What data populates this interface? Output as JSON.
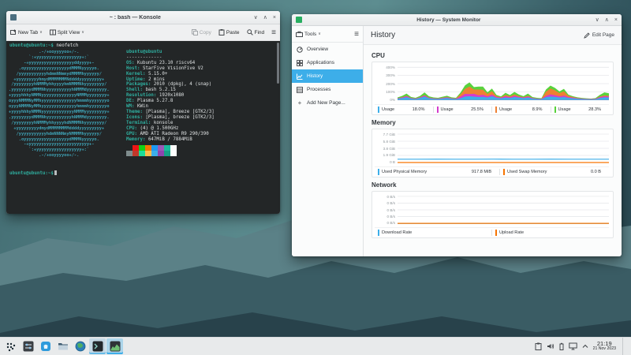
{
  "colors": {
    "accent": "#3daee9",
    "terminal_bg": "#232627",
    "terminal_green": "#2fae9f",
    "ascii_teal": "#3fa3b6"
  },
  "konsole": {
    "window_title": "~ : bash — Konsole",
    "toolbar": {
      "new_tab": "New Tab",
      "split_view": "Split View",
      "copy": "Copy",
      "paste": "Paste",
      "find": "Find"
    },
    "command_line": {
      "prompt": "ubuntu@ubuntu:~$",
      "command": "neofetch"
    },
    "ascii_art": [
      "            .-/+ooyyyyoo+/-.",
      "        `:+yyyyyyyyyyyyyyyyyy+:`",
      "      -+yyyyyyyyyyyyyyyyyyddyyyy+-",
      "    .oyyyyyyyyyyyyyyyyyydMMMNyyyyyo.",
      "   /yyyyyyyyyyyhdmmNNmmydMMMMhyyyyyy/",
      "  +yyyyyyyyyhmydMMMMMMMNddddyyyyyyyyy+",
      " /yyyyyyyyhNMMMyhhyyyyhmNMMMNhyyyyyyyy/",
      ".yyyyyyyydMMMNhyyyyyyyyyyhNMMMdyyyyyyyy.",
      "+yyyyhhhyNMMNyyyyyyyyyyyyyyNMMMyyyyyyyy+",
      "oyyyNMMMNyMMhyyyyyyyyyyyyyyhmmmhyyyyyyyo",
      "oyyyNMMMNyMMhyyyyyyyyyyyyyyhmmmhyyyyyyyo",
      "+yyyyhhhyNMMNyyyyyyyyyyyyyNMMMyyyyyyyyy+",
      ".yyyyyyyydMMMNhyyyyyyyyyyhNMMMdyyyyyyyy.",
      " /yyyyyyyyhNMMMyhhyyyyhdNMMMNhyyyyyyyy/",
      "  +yyyyyyyyydmydMMMMMMMMddddyyyyyyyyy+",
      "   /yyyyyyyyyyyhdmNNNNmyNMMMMhyyyyyy/",
      "    .oyyyyyyyyyyyyyyyyyydMMMNyyyyyo.",
      "      -+yyyyyyyyyyyyyyyyyyyyyyyy+-",
      "        `:+yyyyyyyyyyyyyyyyyy+:`",
      "            .-/+ooyyyyoo+/-."
    ],
    "info_header": "ubuntu@ubuntu",
    "info_divider": "-------------",
    "info": [
      {
        "label": "OS",
        "value": "Kubuntu 23.10 riscv64"
      },
      {
        "label": "Host",
        "value": "StarFive VisionFive V2"
      },
      {
        "label": "Kernel",
        "value": "5.15.0+"
      },
      {
        "label": "Uptime",
        "value": "2 mins"
      },
      {
        "label": "Packages",
        "value": "2010 (dpkg), 4 (snap)"
      },
      {
        "label": "Shell",
        "value": "bash 5.2.15"
      },
      {
        "label": "Resolution",
        "value": "1920x1080"
      },
      {
        "label": "DE",
        "value": "Plasma 5.27.8"
      },
      {
        "label": "WM",
        "value": "KWin"
      },
      {
        "label": "Theme",
        "value": "[Plasma], Breeze [GTK2/3]"
      },
      {
        "label": "Icons",
        "value": "[Plasma], breeze [GTK2/3]"
      },
      {
        "label": "Terminal",
        "value": "konsole"
      },
      {
        "label": "CPU",
        "value": "(4) @ 1.500GHz"
      },
      {
        "label": "GPU",
        "value": "AMD ATI Radeon R9 290/390"
      },
      {
        "label": "Memory",
        "value": "647MiB / 7884MiB"
      }
    ],
    "palette_normal": [
      "#232627",
      "#ed1515",
      "#11d116",
      "#f67400",
      "#1d99f3",
      "#9b59b6",
      "#1abc9c",
      "#fcfcfc"
    ],
    "palette_bright": [
      "#7f8c8d",
      "#c0392b",
      "#1cdc9a",
      "#fdbc4b",
      "#3daee9",
      "#8e44ad",
      "#16a085",
      "#ffffff"
    ]
  },
  "sysmon": {
    "window_title": "History — System Monitor",
    "tools_label": "Tools",
    "sidebar_items": [
      {
        "label": "Overview"
      },
      {
        "label": "Applications"
      },
      {
        "label": "History"
      },
      {
        "label": "Processes"
      },
      {
        "label": "Add New Page..."
      }
    ],
    "page_title": "History",
    "edit_page_label": "Edit Page",
    "section_titles": {
      "cpu": "CPU",
      "memory": "Memory",
      "network": "Network"
    }
  },
  "chart_data": [
    {
      "type": "area",
      "stacked": true,
      "title": "CPU",
      "ymax": 400,
      "ylim": [
        0,
        400
      ],
      "ylabels": [
        "400%",
        "300%",
        "200%",
        "100%",
        "0%"
      ],
      "legend_position": "bottom",
      "series": [
        {
          "name": "Usage",
          "value": "18.0%",
          "color": "#3daee9",
          "points": [
            15,
            22,
            35,
            18,
            12,
            25,
            42,
            20,
            14,
            12,
            18,
            24,
            15,
            12,
            20,
            42,
            46,
            40,
            36,
            38,
            30,
            46,
            26,
            20,
            30,
            24,
            36,
            28,
            22,
            30,
            18,
            12,
            10,
            34,
            42,
            38,
            30,
            36,
            25,
            20,
            15,
            12,
            10,
            8,
            10,
            24,
            32,
            30
          ]
        },
        {
          "name": "Usage",
          "value": "25.5%",
          "color": "#d43ccc",
          "points": [
            4,
            8,
            12,
            5,
            4,
            6,
            12,
            6,
            5,
            4,
            6,
            8,
            5,
            4,
            20,
            32,
            26,
            36,
            20,
            26,
            14,
            20,
            10,
            8,
            16,
            10,
            16,
            10,
            8,
            12,
            5,
            4,
            3,
            16,
            26,
            20,
            14,
            18,
            10,
            8,
            5,
            4,
            3,
            3,
            4,
            10,
            14,
            12
          ]
        },
        {
          "name": "Usage",
          "value": "8.9%",
          "color": "#ee8033",
          "points": [
            2,
            3,
            5,
            2,
            2,
            3,
            6,
            3,
            2,
            2,
            3,
            4,
            2,
            2,
            30,
            62,
            92,
            52,
            72,
            60,
            30,
            42,
            10,
            5,
            16,
            10,
            16,
            8,
            5,
            10,
            3,
            2,
            2,
            52,
            72,
            60,
            40,
            52,
            15,
            8,
            4,
            3,
            2,
            2,
            2,
            8,
            10,
            8
          ]
        },
        {
          "name": "Usage",
          "value": "28.3%",
          "color": "#58d23d",
          "points": [
            10,
            16,
            26,
            12,
            8,
            15,
            32,
            15,
            10,
            8,
            12,
            16,
            10,
            8,
            20,
            42,
            52,
            30,
            36,
            40,
            20,
            32,
            15,
            10,
            26,
            16,
            30,
            20,
            12,
            26,
            10,
            8,
            6,
            26,
            36,
            30,
            20,
            30,
            15,
            10,
            8,
            6,
            5,
            4,
            6,
            20,
            36,
            32
          ]
        }
      ]
    },
    {
      "type": "line",
      "stacked": false,
      "title": "Memory",
      "ymax": 7.7,
      "ylim": [
        0,
        7.7
      ],
      "ylabels": [
        "7.7 GiB",
        "5.8 GiB",
        "3.8 GiB",
        "1.9 GiB",
        "0 B"
      ],
      "legend_position": "bottom",
      "series": [
        {
          "name": "Used Physical Memory",
          "value": "917.8 MiB",
          "color": "#3daee9",
          "points": [
            0.9,
            0.9,
            0.91,
            0.9,
            0.9,
            0.92,
            0.9,
            0.9,
            0.91,
            0.9,
            0.9,
            0.9
          ]
        },
        {
          "name": "Used Swap Memory",
          "value": "0.0 B",
          "color": "#f67400",
          "points": [
            0,
            0,
            0,
            0,
            0,
            0,
            0,
            0,
            0,
            0,
            0,
            0
          ]
        }
      ]
    },
    {
      "type": "line",
      "stacked": false,
      "title": "Network",
      "ymax": 1,
      "ylim": [
        0,
        1
      ],
      "ylabels": [
        "0 B/s",
        "0 B/s",
        "0 B/s",
        "0 B/s",
        "0 B/s"
      ],
      "legend_position": "bottom",
      "series": [
        {
          "name": "Download Rate",
          "value": "",
          "color": "#3daee9",
          "points": [
            0,
            0,
            0,
            0,
            0,
            0,
            0,
            0,
            0,
            0,
            0,
            0
          ]
        },
        {
          "name": "Upload Rate",
          "value": "",
          "color": "#f67400",
          "points": [
            0,
            0,
            0,
            0,
            0,
            0,
            0,
            0,
            0,
            0,
            0,
            0
          ]
        }
      ]
    }
  ],
  "taskbar": {
    "time": "21:19",
    "date": "21 Nov 2023"
  }
}
